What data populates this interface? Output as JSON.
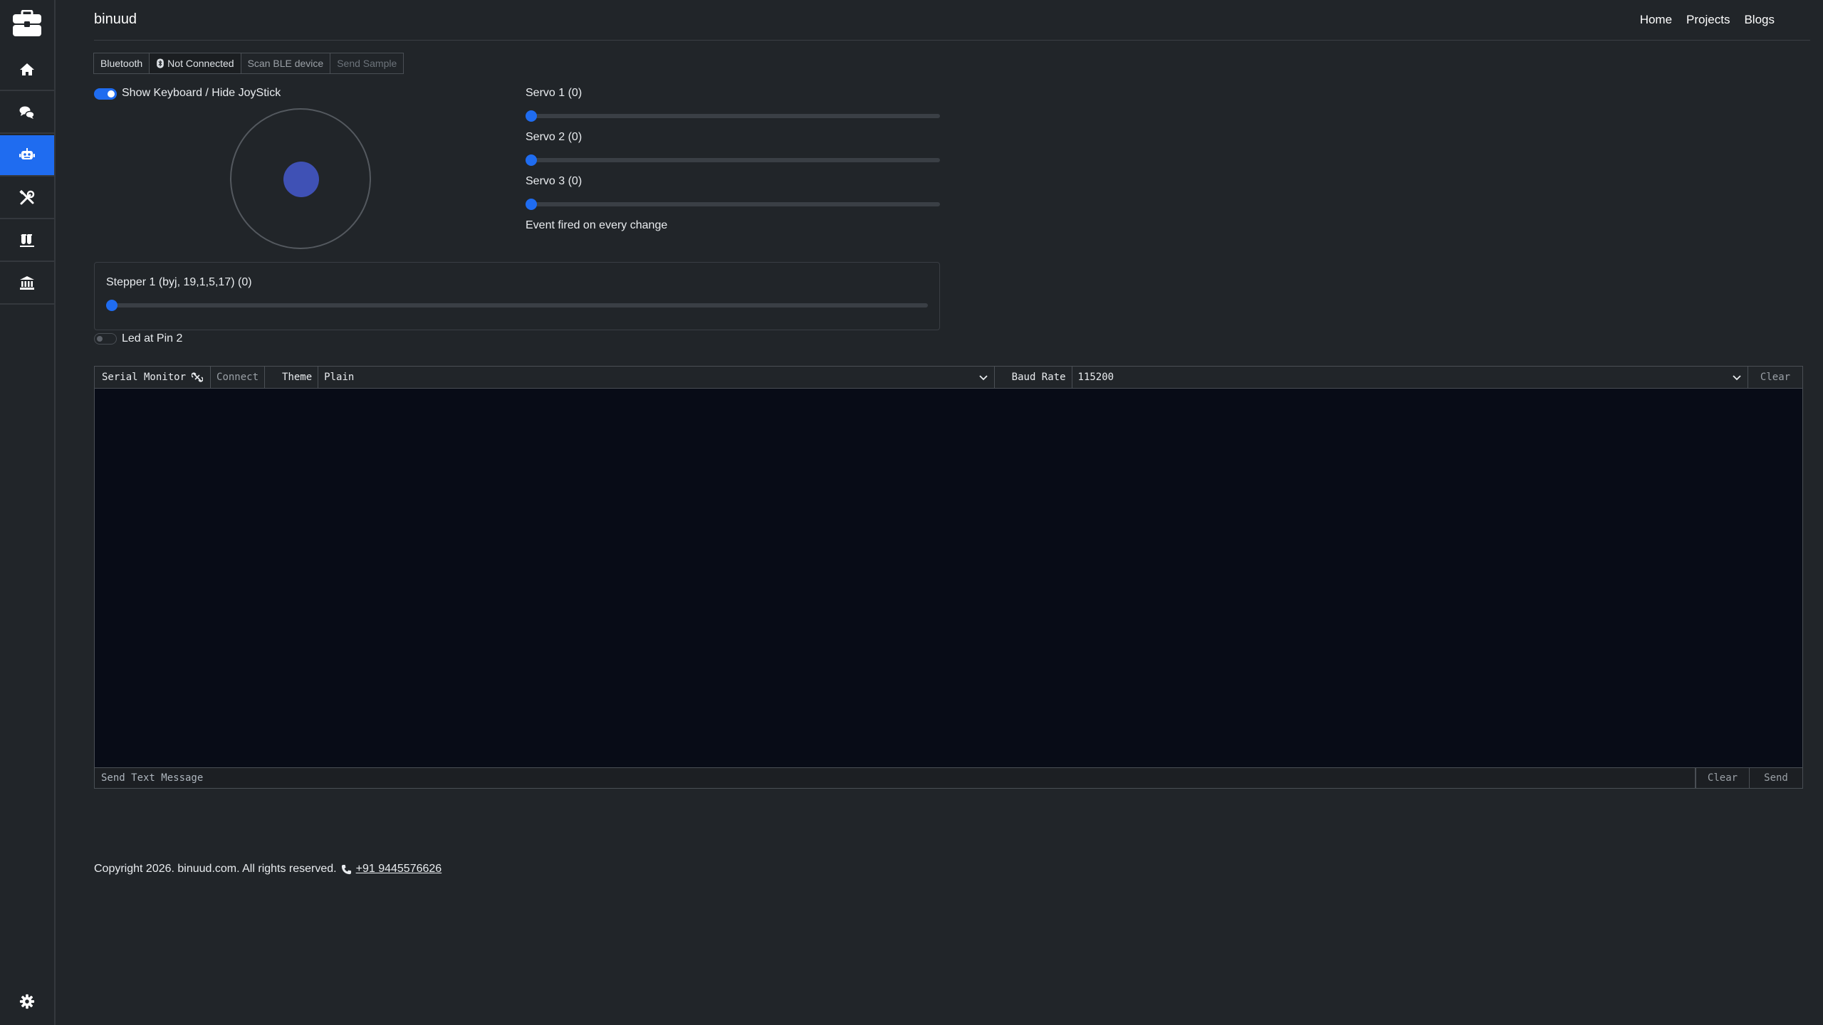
{
  "brand": "binuud",
  "nav": {
    "home": "Home",
    "projects": "Projects",
    "blogs": "Blogs"
  },
  "sidebar": {
    "items": [
      {
        "icon": "home-icon",
        "active": false
      },
      {
        "icon": "chat-icon",
        "active": false
      },
      {
        "icon": "robot-icon",
        "active": true
      },
      {
        "icon": "tools-icon",
        "active": false
      },
      {
        "icon": "lab-icon",
        "active": false
      },
      {
        "icon": "bank-icon",
        "active": false
      }
    ],
    "settings_icon": "gear-icon"
  },
  "bluetooth": {
    "label": "Bluetooth",
    "status": "Not Connected",
    "scan_label": "Scan BLE device",
    "send_sample_label": "Send Sample"
  },
  "controls": {
    "keyboard_toggle_label": "Show Keyboard / Hide JoyStick",
    "keyboard_toggle_on": true,
    "servos": [
      {
        "label": "Servo 1 (0)",
        "value": 0
      },
      {
        "label": "Servo 2 (0)",
        "value": 0
      },
      {
        "label": "Servo 3 (0)",
        "value": 0
      }
    ],
    "servo_note": "Event fired on every change",
    "stepper": {
      "label": "Stepper 1 (byj, 19,1,5,17) (0)",
      "value": 0
    },
    "led_label": "Led at Pin 2",
    "led_on": false
  },
  "serial": {
    "title": "Serial Monitor",
    "connect_label": "Connect",
    "theme_label": "Theme",
    "theme_value": "Plain",
    "baud_label": "Baud Rate",
    "baud_value": "115200",
    "clear_label": "Clear",
    "send_placeholder": "Send Text Message",
    "send_clear_label": "Clear",
    "send_label": "Send"
  },
  "footer": {
    "copyright": "Copyright 2026. binuud.com. All rights reserved.",
    "phone": "+91 9445576626"
  },
  "colors": {
    "accent": "#1f6cf0",
    "background": "#212529",
    "terminal": "#080c17",
    "joystick_knob": "#3f51b5"
  }
}
